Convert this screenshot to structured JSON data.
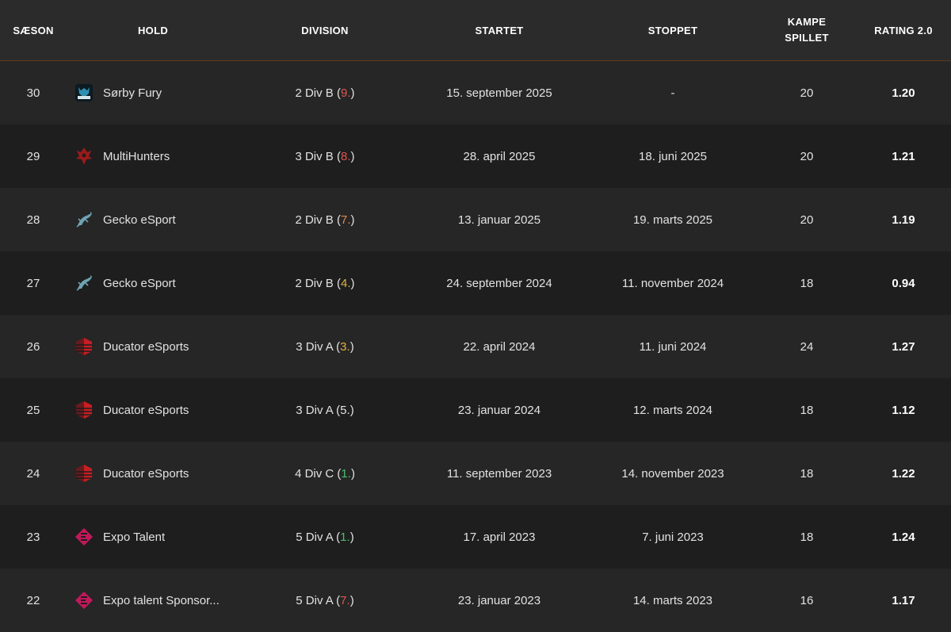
{
  "header": {
    "season": "SÆSON",
    "team": "HOLD",
    "division": "DIVISION",
    "started": "STARTET",
    "stopped": "STOPPET",
    "games_line1": "KAMPE",
    "games_line2": "SPILLET",
    "rating": "RATING 2.0"
  },
  "colors": {
    "rank_red": "#e05555",
    "rank_yellow": "#e0b341",
    "rank_orange": "#e08a4c",
    "rank_green": "#4bbf6b",
    "rank_white": "#e2e2e2"
  },
  "rows": [
    {
      "season": "30",
      "team": "Sørby Fury",
      "logo": "sorby-fury-logo",
      "division": "2 Div B",
      "rank": "9.",
      "rank_color": "#e05555",
      "started": "15. september 2025",
      "stopped": "-",
      "games": "20",
      "rating": "1.20"
    },
    {
      "season": "29",
      "team": "MultiHunters",
      "logo": "multihunters-logo",
      "division": "3 Div B",
      "rank": "8.",
      "rank_color": "#e05555",
      "started": "28. april 2025",
      "stopped": "18. juni 2025",
      "games": "20",
      "rating": "1.21"
    },
    {
      "season": "28",
      "team": "Gecko eSport",
      "logo": "gecko-esport-logo",
      "division": "2 Div B",
      "rank": "7.",
      "rank_color": "#e08a4c",
      "started": "13. januar 2025",
      "stopped": "19. marts 2025",
      "games": "20",
      "rating": "1.19"
    },
    {
      "season": "27",
      "team": "Gecko eSport",
      "logo": "gecko-esport-logo",
      "division": "2 Div B",
      "rank": "4.",
      "rank_color": "#e0b341",
      "started": "24. september 2024",
      "stopped": "11. november 2024",
      "games": "18",
      "rating": "0.94"
    },
    {
      "season": "26",
      "team": "Ducator eSports",
      "logo": "ducator-esports-logo",
      "division": "3 Div A",
      "rank": "3.",
      "rank_color": "#e0b341",
      "started": "22. april 2024",
      "stopped": "11. juni 2024",
      "games": "24",
      "rating": "1.27"
    },
    {
      "season": "25",
      "team": "Ducator eSports",
      "logo": "ducator-esports-logo",
      "division": "3 Div A",
      "rank": "5.",
      "rank_color": "#e2e2e2",
      "started": "23. januar 2024",
      "stopped": "12. marts 2024",
      "games": "18",
      "rating": "1.12"
    },
    {
      "season": "24",
      "team": "Ducator eSports",
      "logo": "ducator-esports-logo",
      "division": "4 Div C",
      "rank": "1.",
      "rank_color": "#4bbf6b",
      "started": "11. september 2023",
      "stopped": "14. november 2023",
      "games": "18",
      "rating": "1.22"
    },
    {
      "season": "23",
      "team": "Expo Talent",
      "logo": "expo-talent-logo",
      "division": "5 Div A",
      "rank": "1.",
      "rank_color": "#4bbf6b",
      "started": "17. april 2023",
      "stopped": "7. juni 2023",
      "games": "18",
      "rating": "1.24"
    },
    {
      "season": "22",
      "team": "Expo talent Sponsor...",
      "logo": "expo-talent-logo",
      "division": "5 Div A",
      "rank": "7.",
      "rank_color": "#e05555",
      "started": "23. januar 2023",
      "stopped": "14. marts 2023",
      "games": "16",
      "rating": "1.17"
    }
  ]
}
